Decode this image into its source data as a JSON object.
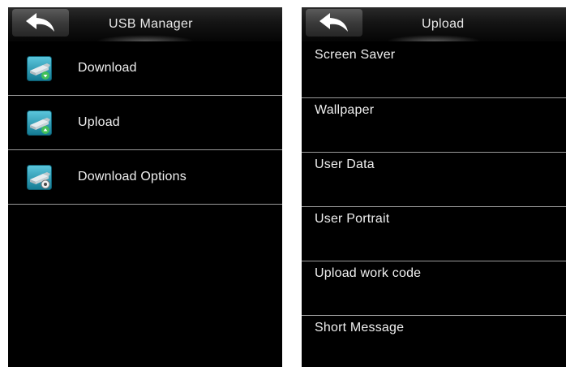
{
  "left_screen": {
    "title": "USB Manager",
    "items": [
      {
        "label": "Download",
        "icon": "usb-download-icon"
      },
      {
        "label": "Upload",
        "icon": "usb-upload-icon"
      },
      {
        "label": "Download Options",
        "icon": "usb-options-icon"
      }
    ]
  },
  "right_screen": {
    "title": "Upload",
    "items": [
      {
        "label": "Screen Saver"
      },
      {
        "label": "Wallpaper"
      },
      {
        "label": "User Data"
      },
      {
        "label": "User Portrait"
      },
      {
        "label": "Upload work code"
      },
      {
        "label": "Short Message"
      }
    ]
  },
  "colors": {
    "background": "#000000",
    "text": "#f0f0f0",
    "divider": "#9a9a9a",
    "icon_tile": "#1f8fa6",
    "icon_accent": "#41c05a"
  }
}
